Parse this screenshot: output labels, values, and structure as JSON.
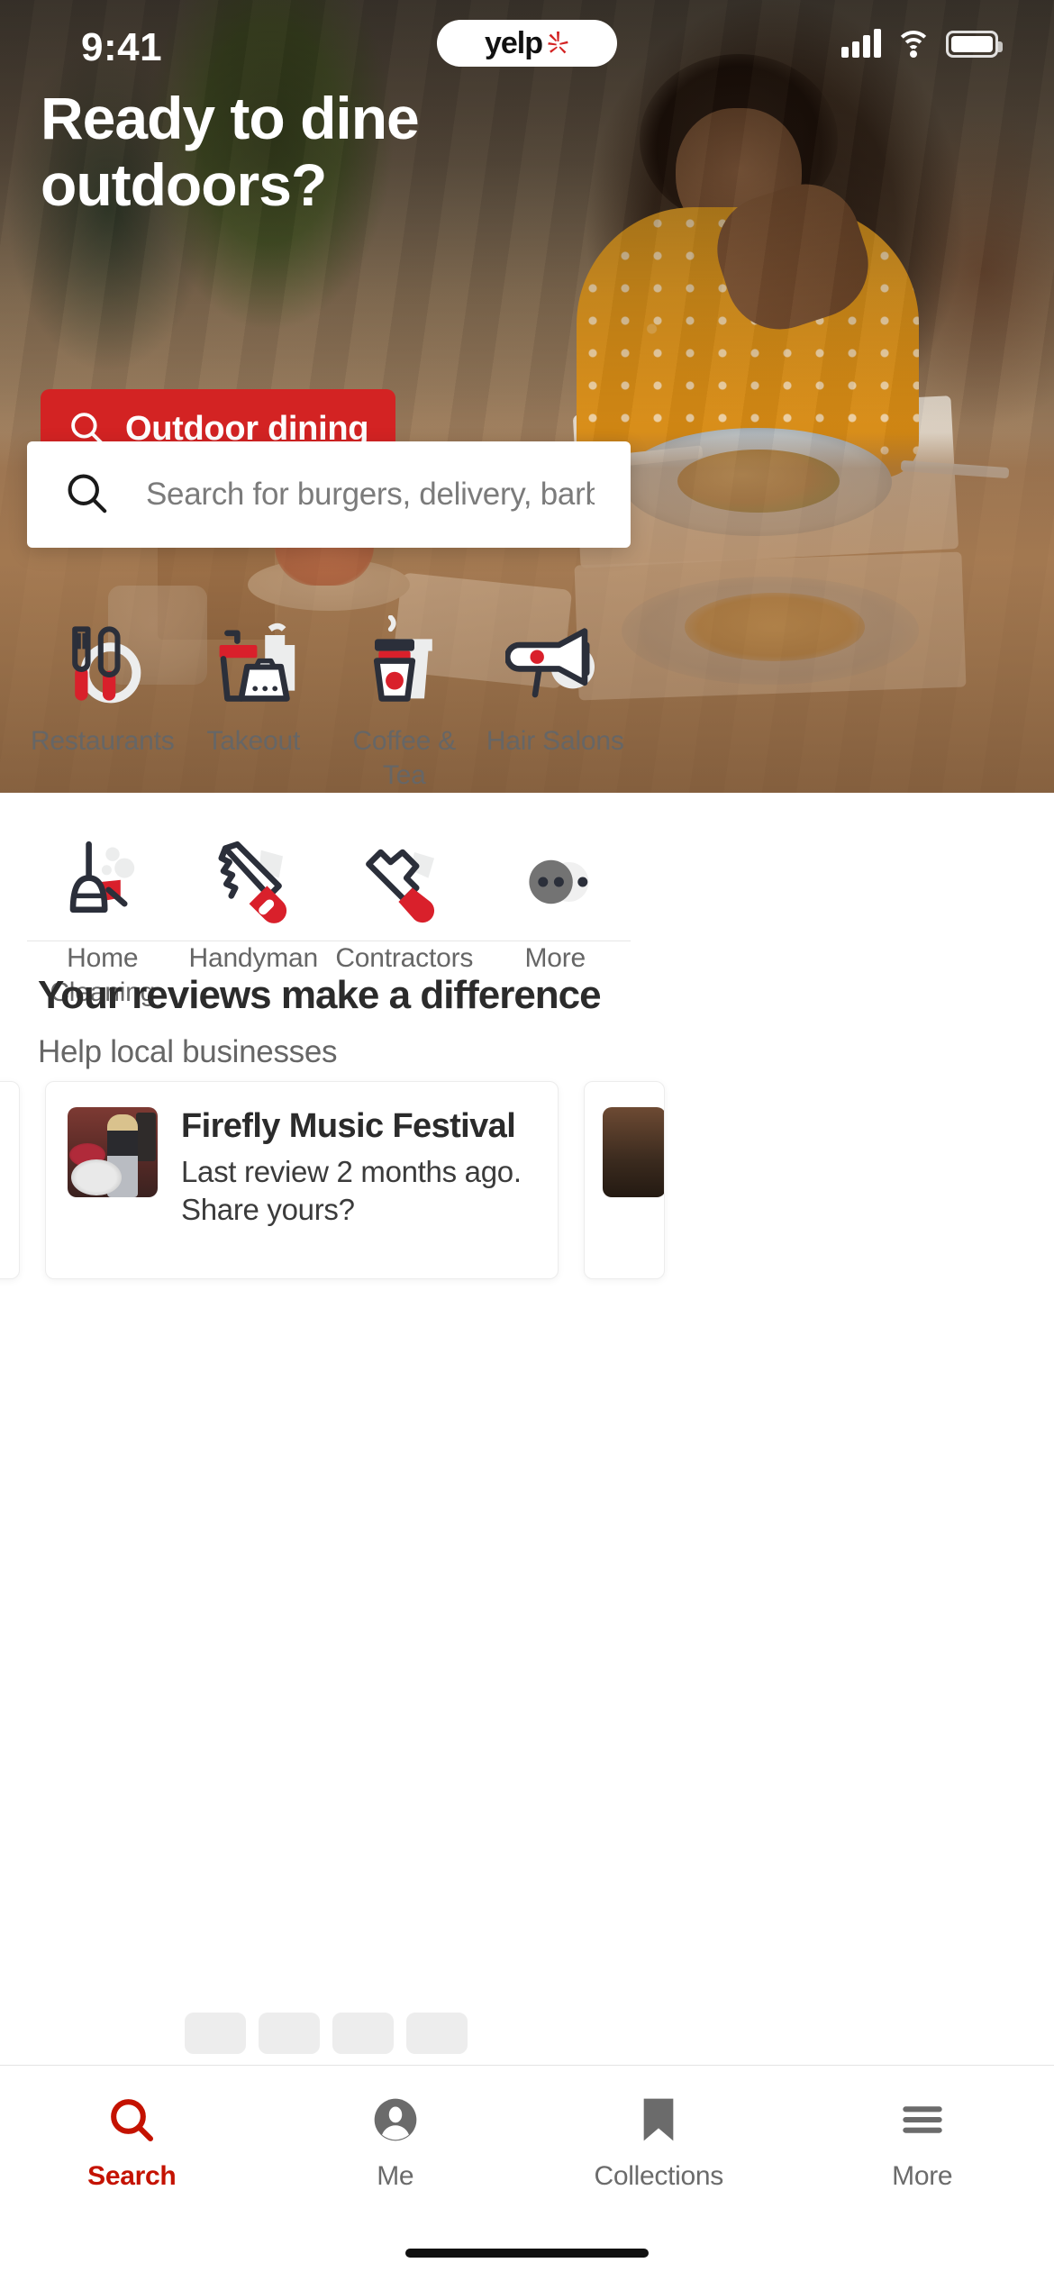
{
  "status_bar": {
    "time": "9:41",
    "brand_word": "yelp",
    "icons": [
      "cellular-signal-icon",
      "wifi-icon",
      "battery-icon"
    ]
  },
  "hero": {
    "title": "Ready to dine outdoors?",
    "cta_label": "Outdoor dining",
    "cta_icon": "search-icon",
    "cta_color": "#d32323"
  },
  "search": {
    "placeholder": "Search for burgers, delivery, barbers on...",
    "icon": "search-icon"
  },
  "categories": [
    {
      "label": "Restaurants",
      "icon": "fork-knife-icon"
    },
    {
      "label": "Takeout",
      "icon": "takeout-box-icon"
    },
    {
      "label": "Coffee & Tea",
      "icon": "coffee-cup-icon"
    },
    {
      "label": "Hair Salons",
      "icon": "hair-dryer-icon"
    },
    {
      "label": "Home Cleaning",
      "icon": "broom-dustpan-icon"
    },
    {
      "label": "Handyman",
      "icon": "handsaw-icon"
    },
    {
      "label": "Contractors",
      "icon": "hammer-wrench-icon"
    },
    {
      "label": "More",
      "icon": "ellipsis-icon"
    }
  ],
  "reviews_section": {
    "heading": "Your reviews make a difference",
    "subheading": "Help local businesses",
    "cards": [
      {
        "title": "Firefly Music Festival",
        "subtitle": "Last review 2 months ago. Share yours?",
        "thumbnail": "music-festival-photo"
      }
    ]
  },
  "tab_bar": {
    "active_index": 0,
    "active_color": "#c41200",
    "inactive_color": "#6b6b6b",
    "tabs": [
      {
        "label": "Search",
        "icon": "search-icon"
      },
      {
        "label": "Me",
        "icon": "user-avatar-icon"
      },
      {
        "label": "Collections",
        "icon": "bookmark-icon"
      },
      {
        "label": "More",
        "icon": "hamburger-menu-icon"
      }
    ]
  },
  "colors": {
    "yelp_red": "#d32323",
    "active_red": "#c41200",
    "icon_navy": "#2b2f3a",
    "text_dark": "#2b2b2b",
    "text_grey": "#666666"
  }
}
